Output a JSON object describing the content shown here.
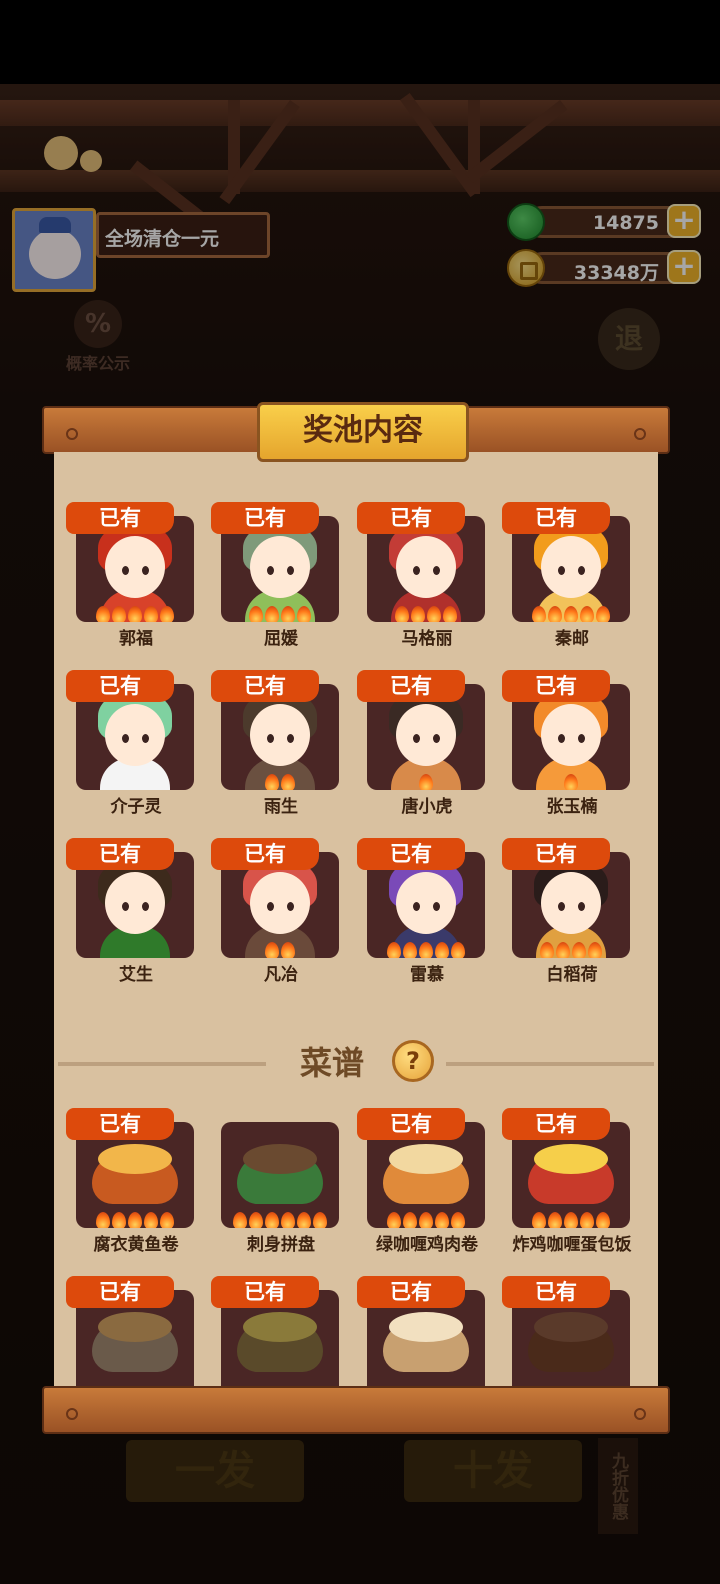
{
  "player": {
    "name": "全场清仓一元"
  },
  "currency": {
    "jade": {
      "icon": "jade-icon",
      "value": "14875"
    },
    "coins": {
      "icon": "coin-icon",
      "value": "33348万"
    }
  },
  "side": {
    "probability_label": "概率公示",
    "probability_icon": "%",
    "exit_label": "退"
  },
  "bottom": {
    "single_label": "一发",
    "ten_label": "十发",
    "discount_label": "九折优惠"
  },
  "panel": {
    "title": "奖池内容",
    "characters": [
      {
        "name": "郭福",
        "owned_label": "已有",
        "stars": 5
      },
      {
        "name": "屈媛",
        "owned_label": "已有",
        "stars": 4
      },
      {
        "name": "马格丽",
        "owned_label": "已有",
        "stars": 4
      },
      {
        "name": "秦邮",
        "owned_label": "已有",
        "stars": 5
      },
      {
        "name": "介子灵",
        "owned_label": "已有",
        "stars": 0
      },
      {
        "name": "雨生",
        "owned_label": "已有",
        "stars": 2
      },
      {
        "name": "唐小虎",
        "owned_label": "已有",
        "stars": 1
      },
      {
        "name": "张玉楠",
        "owned_label": "已有",
        "stars": 1
      },
      {
        "name": "艾生",
        "owned_label": "已有",
        "stars": 0
      },
      {
        "name": "凡冶",
        "owned_label": "已有",
        "stars": 2
      },
      {
        "name": "雷慕",
        "owned_label": "已有",
        "stars": 5
      },
      {
        "name": "白稻荷",
        "owned_label": "已有",
        "stars": 4
      }
    ],
    "recipe_section": {
      "title": "菜谱",
      "help_icon": "?"
    },
    "recipes": [
      {
        "name": "腐衣黄鱼卷",
        "owned_label": "已有",
        "stars": 5
      },
      {
        "name": "刺身拼盘",
        "owned_label": "",
        "stars": 6
      },
      {
        "name": "绿咖喱鸡肉卷",
        "owned_label": "已有",
        "stars": 5
      },
      {
        "name": "炸鸡咖喱蛋包饭",
        "owned_label": "已有",
        "stars": 5
      },
      {
        "name": "",
        "owned_label": "已有",
        "stars": 0
      },
      {
        "name": "",
        "owned_label": "已有",
        "stars": 0
      },
      {
        "name": "",
        "owned_label": "已有",
        "stars": 0
      },
      {
        "name": "",
        "owned_label": "已有",
        "stars": 0
      }
    ]
  },
  "colors": {
    "accent": "#dd4a0c",
    "panel_bg": "#d9c1a0",
    "gold": "#f3b52a"
  }
}
